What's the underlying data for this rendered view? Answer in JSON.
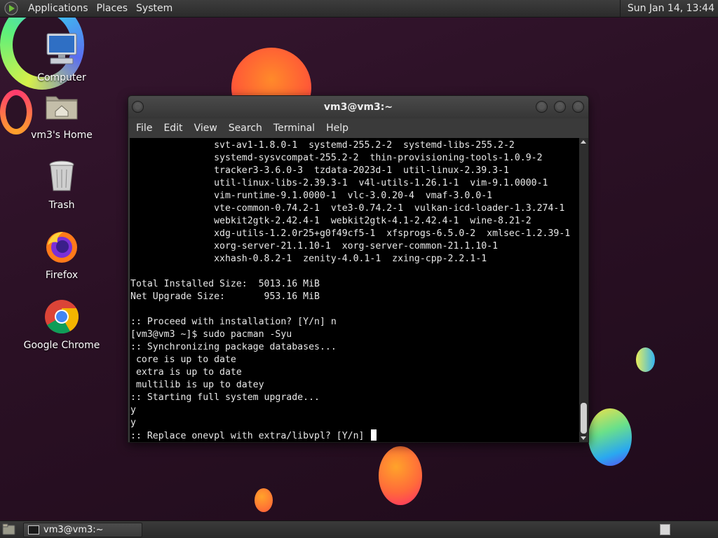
{
  "top_panel": {
    "menus": [
      "Applications",
      "Places",
      "System"
    ],
    "clock": "Sun Jan 14, 13:44"
  },
  "desktop_icons": [
    {
      "label": "Computer",
      "icon": "computer-icon"
    },
    {
      "label": "vm3's Home",
      "icon": "home-folder-icon"
    },
    {
      "label": "Trash",
      "icon": "trash-icon"
    },
    {
      "label": "Firefox",
      "icon": "firefox-icon"
    },
    {
      "label": "Google Chrome",
      "icon": "chrome-icon"
    }
  ],
  "terminal": {
    "title": "vm3@vm3:~",
    "menus": [
      "File",
      "Edit",
      "View",
      "Search",
      "Terminal",
      "Help"
    ],
    "lines": [
      "               svt-av1-1.8.0-1  systemd-255.2-2  systemd-libs-255.2-2",
      "               systemd-sysvcompat-255.2-2  thin-provisioning-tools-1.0.9-2",
      "               tracker3-3.6.0-3  tzdata-2023d-1  util-linux-2.39.3-1",
      "               util-linux-libs-2.39.3-1  v4l-utils-1.26.1-1  vim-9.1.0000-1",
      "               vim-runtime-9.1.0000-1  vlc-3.0.20-4  vmaf-3.0.0-1",
      "               vte-common-0.74.2-1  vte3-0.74.2-1  vulkan-icd-loader-1.3.274-1",
      "               webkit2gtk-2.42.4-1  webkit2gtk-4.1-2.42.4-1  wine-8.21-2",
      "               xdg-utils-1.2.0r25+g0f49cf5-1  xfsprogs-6.5.0-2  xmlsec-1.2.39-1",
      "               xorg-server-21.1.10-1  xorg-server-common-21.1.10-1",
      "               xxhash-0.8.2-1  zenity-4.0.1-1  zxing-cpp-2.2.1-1",
      "",
      "Total Installed Size:  5013.16 MiB",
      "Net Upgrade Size:       953.16 MiB",
      "",
      ":: Proceed with installation? [Y/n] n",
      "[vm3@vm3 ~]$ sudo pacman -Syu",
      ":: Synchronizing package databases...",
      " core is up to date",
      " extra is up to date",
      " multilib is up to datey",
      ":: Starting full system upgrade...",
      "y",
      "y",
      ":: Replace onevpl with extra/libvpl? [Y/n] "
    ]
  },
  "taskbar": {
    "task_label": "vm3@vm3:~"
  }
}
